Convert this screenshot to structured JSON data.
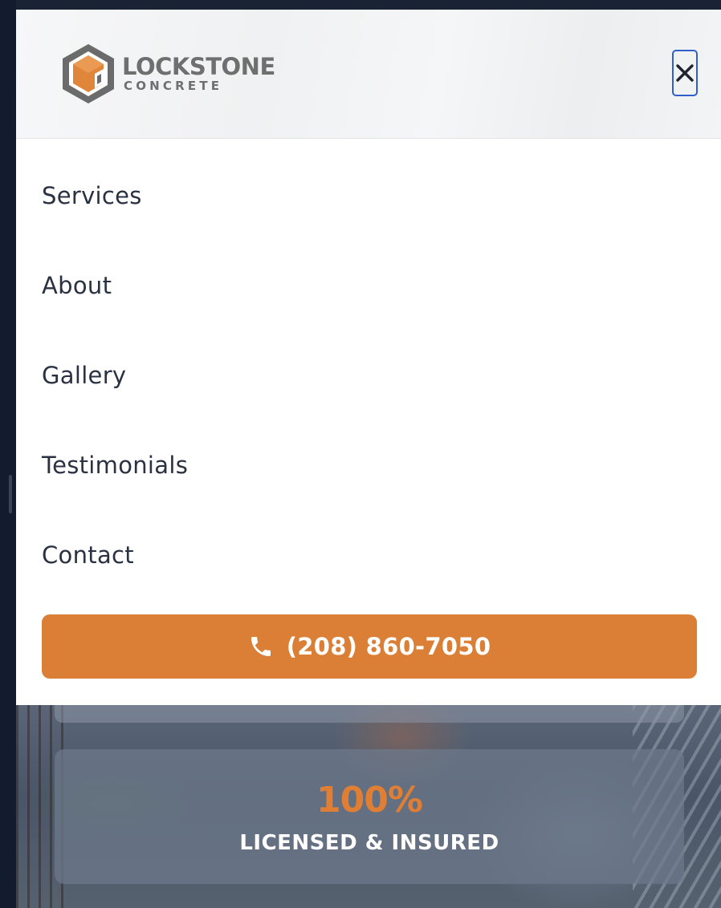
{
  "brand": {
    "name_line1": "LOCKSTONE",
    "name_line2": "CONCRETE",
    "logo_icon": "hexagon-cube-logo",
    "accent_color": "#db7f36",
    "text_color": "#6f6f6f"
  },
  "header": {
    "close_icon": "close-icon"
  },
  "menu": {
    "items": [
      {
        "label": "Services"
      },
      {
        "label": "About"
      },
      {
        "label": "Gallery"
      },
      {
        "label": "Testimonials"
      },
      {
        "label": "Contact"
      }
    ],
    "call_button": {
      "icon": "phone-icon",
      "label": "(208) 860-7050",
      "color": "#db7f36"
    }
  },
  "hero": {
    "stat": {
      "value": "100%",
      "label": "LICENSED & INSURED",
      "value_color": "#e07f34"
    }
  }
}
